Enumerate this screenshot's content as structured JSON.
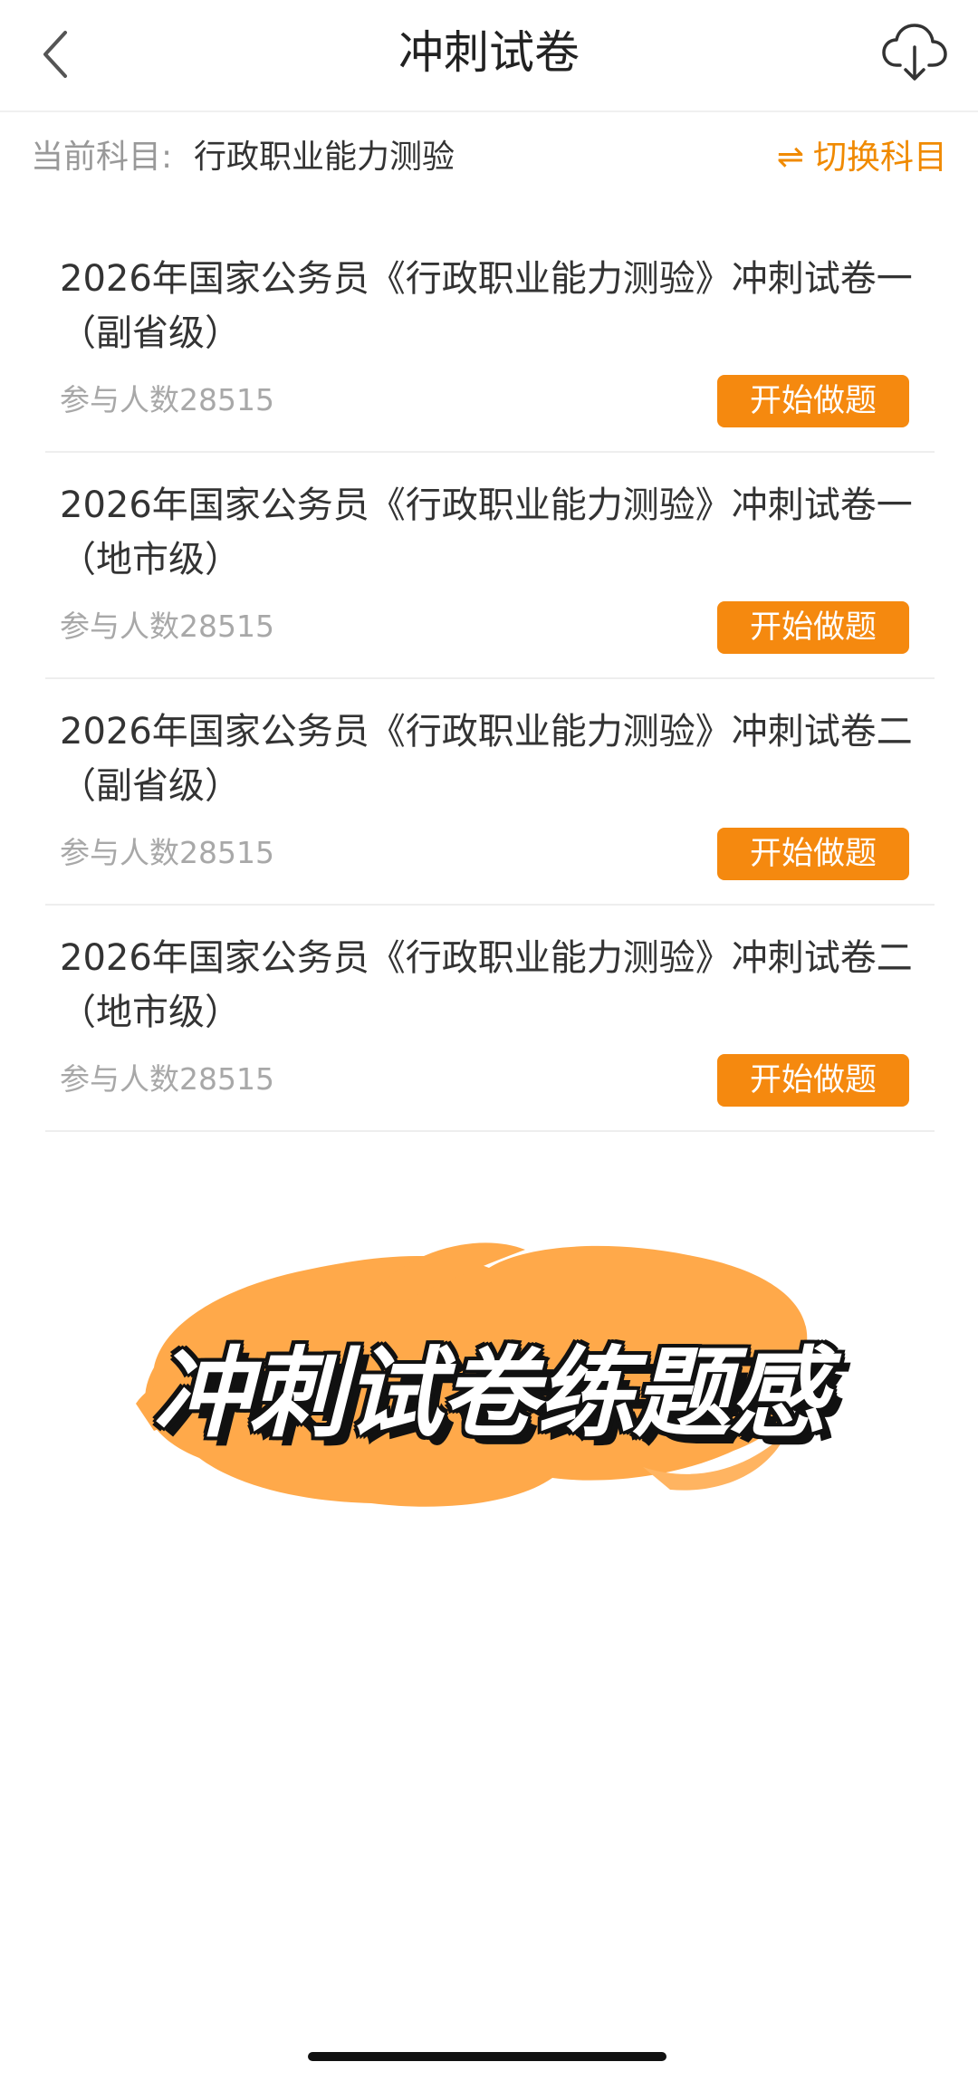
{
  "header": {
    "title": "冲刺试卷"
  },
  "subject_bar": {
    "label": "当前科目:",
    "value": "行政职业能力测验",
    "switch_label": "切换科目",
    "switch_icon": "⇌"
  },
  "papers": [
    {
      "title": "2026年国家公务员《行政职业能力测验》冲刺试卷一（副省级）",
      "participants": "参与人数28515",
      "button": "开始做题"
    },
    {
      "title": "2026年国家公务员《行政职业能力测验》冲刺试卷一（地市级）",
      "participants": "参与人数28515",
      "button": "开始做题"
    },
    {
      "title": "2026年国家公务员《行政职业能力测验》冲刺试卷二（副省级）",
      "participants": "参与人数28515",
      "button": "开始做题"
    },
    {
      "title": "2026年国家公务员《行政职业能力测验》冲刺试卷二（地市级）",
      "participants": "参与人数28515",
      "button": "开始做题"
    }
  ],
  "promo": {
    "text": "冲刺试卷练题感"
  },
  "colors": {
    "accent": "#f5890f",
    "brush": "#ffa94a"
  }
}
